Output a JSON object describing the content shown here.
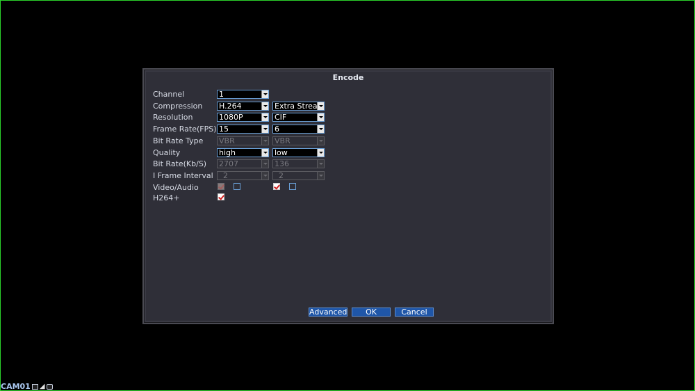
{
  "dialog": {
    "title": "Encode"
  },
  "form": {
    "rows": [
      {
        "key": "channel",
        "label": "Channel",
        "main": "1",
        "extra": null
      },
      {
        "key": "compression",
        "label": "Compression",
        "main": "H.264",
        "extra": "Extra Stream"
      },
      {
        "key": "resolution",
        "label": "Resolution",
        "main": "1080P",
        "extra": "CIF"
      },
      {
        "key": "frame_rate",
        "label": "Frame Rate(FPS)",
        "main": "15",
        "extra": "6"
      },
      {
        "key": "bit_rate_type",
        "label": "Bit Rate Type",
        "main": "VBR",
        "extra": "VBR"
      },
      {
        "key": "quality",
        "label": "Quality",
        "main": "high",
        "extra": "low"
      },
      {
        "key": "bit_rate",
        "label": "Bit Rate(Kb/S)",
        "main": "2707",
        "extra": "136"
      },
      {
        "key": "i_frame",
        "label": "I Frame Interval",
        "main": "2",
        "extra": "2"
      }
    ],
    "video_audio": {
      "label": "Video/Audio",
      "main_video": true,
      "main_audio": false,
      "extra_video": true,
      "extra_audio": false
    },
    "h264plus": {
      "label": "H264+",
      "checked": true
    }
  },
  "buttons": {
    "advanced": "Advanced",
    "ok": "OK",
    "cancel": "Cancel"
  },
  "status": {
    "camera": "CAM01"
  },
  "colors": {
    "accent": "#1f56a8",
    "field_border": "#6aa0d8",
    "panel": "#2f2f38"
  }
}
